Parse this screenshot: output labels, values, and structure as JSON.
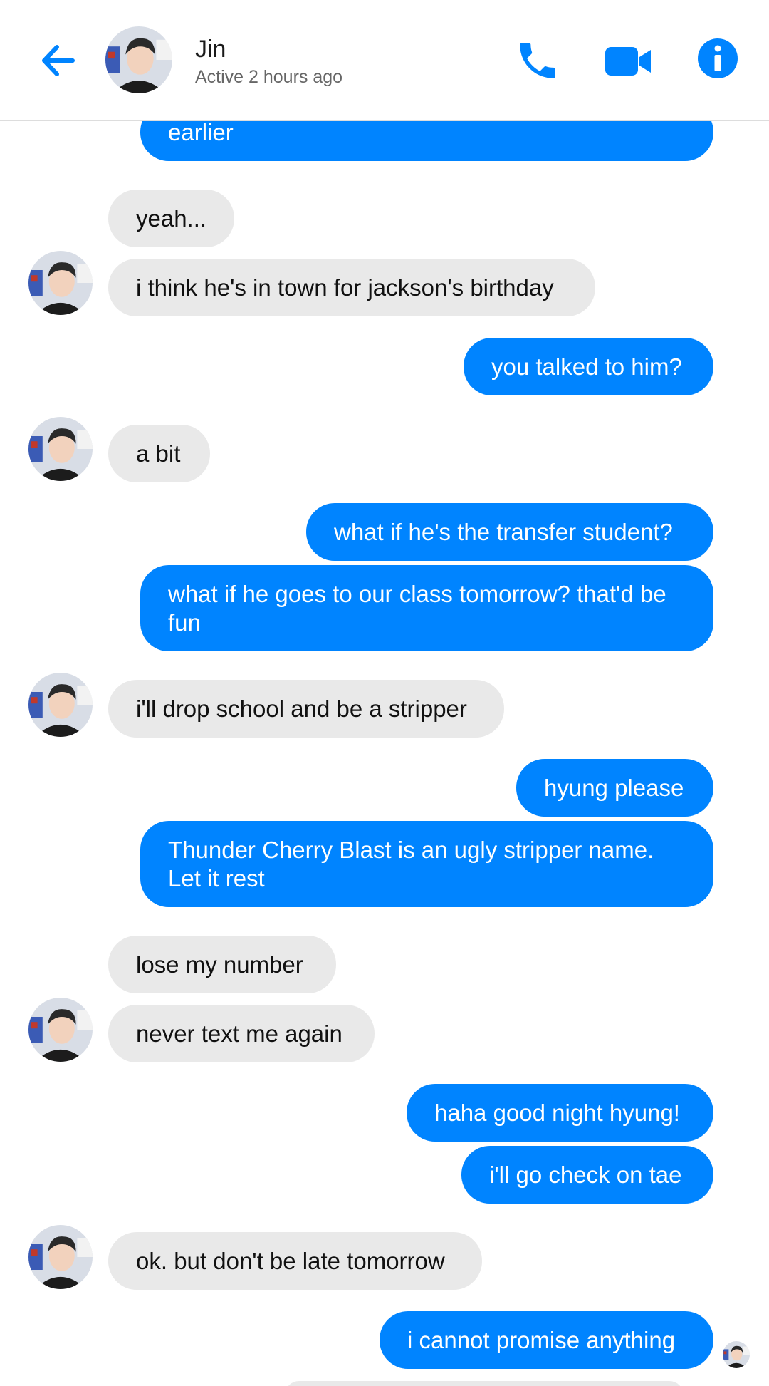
{
  "header": {
    "name": "Jin",
    "status": "Active 2 hours ago",
    "accent": "#0084ff",
    "icons": [
      "back-arrow-icon",
      "phone-icon",
      "video-camera-icon",
      "info-icon"
    ]
  },
  "messages": [
    {
      "from": "me",
      "text": "earlier"
    },
    {
      "from": "them",
      "text": "yeah..."
    },
    {
      "from": "them",
      "text": "i think he's in town for jackson's birthday"
    },
    {
      "from": "me",
      "text": "you talked to him?"
    },
    {
      "from": "them",
      "text": "a bit"
    },
    {
      "from": "me",
      "text": "what if he's the transfer student?"
    },
    {
      "from": "me",
      "text": "what if he goes to our class tomorrow? that'd be fun"
    },
    {
      "from": "them",
      "text": "i'll drop school and be a stripper"
    },
    {
      "from": "me",
      "text": "hyung please"
    },
    {
      "from": "me",
      "text": "Thunder Cherry Blast is an ugly stripper name. Let it rest"
    },
    {
      "from": "them",
      "text": "lose my number"
    },
    {
      "from": "them",
      "text": "never text me again"
    },
    {
      "from": "me",
      "text": "haha good night hyung!"
    },
    {
      "from": "me",
      "text": "i'll go check on tae"
    },
    {
      "from": "them",
      "text": "ok. but don't be late tomorrow"
    },
    {
      "from": "me",
      "text": "i cannot promise anything"
    }
  ],
  "colors": {
    "outgoing": "#0084ff",
    "incoming": "#e9e9e9"
  }
}
